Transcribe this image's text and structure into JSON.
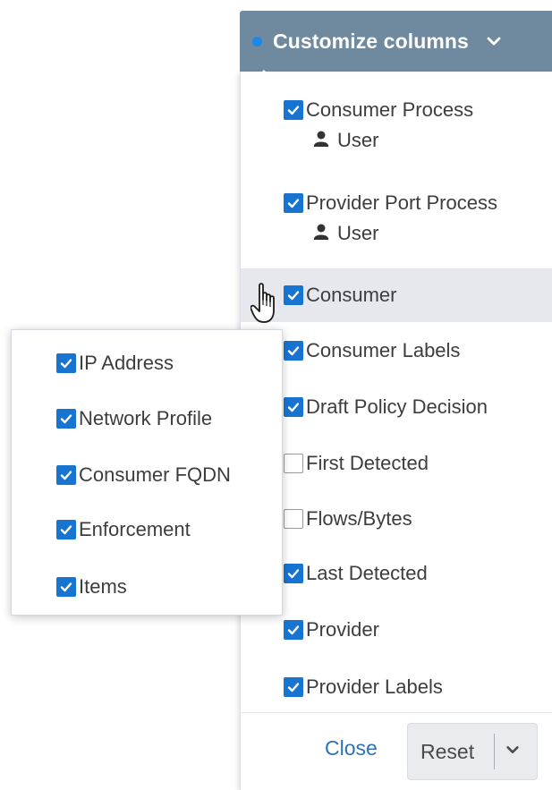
{
  "header": {
    "label": "Customize columns",
    "status_dot_color": "#1e88e5",
    "background_color": "#6f8a9e"
  },
  "columns": [
    {
      "label": "Consumer Process",
      "checked": true,
      "sub_label": "User"
    },
    {
      "label": "Provider Port Process",
      "checked": true,
      "sub_label": "User"
    },
    {
      "label": "Consumer",
      "checked": true,
      "highlighted": true
    },
    {
      "label": "Consumer Labels",
      "checked": true
    },
    {
      "label": "Draft Policy Decision",
      "checked": true
    },
    {
      "label": "First Detected",
      "checked": false
    },
    {
      "label": "Flows/Bytes",
      "checked": false
    },
    {
      "label": "Last Detected",
      "checked": true
    },
    {
      "label": "Provider",
      "checked": true
    },
    {
      "label": "Provider Labels",
      "checked": true
    }
  ],
  "footer": {
    "close_label": "Close",
    "reset_label": "Reset"
  },
  "consumer_submenu": [
    {
      "label": "IP Address",
      "checked": true
    },
    {
      "label": "Network Profile",
      "checked": true
    },
    {
      "label": "Consumer FQDN",
      "checked": true
    },
    {
      "label": "Enforcement",
      "checked": true
    },
    {
      "label": "Items",
      "checked": true
    }
  ],
  "colors": {
    "checkbox_checked": "#1774d0",
    "link": "#2d73b7",
    "highlight_row": "#e6e8ee"
  }
}
